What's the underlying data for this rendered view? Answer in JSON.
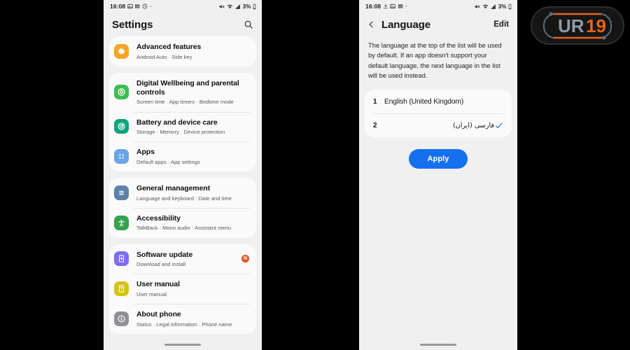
{
  "status_bar": {
    "time": "16:08",
    "battery": "3%",
    "left_icons": [
      "gallery-icon",
      "apps-icon",
      "clock-icon",
      "dot-icon"
    ],
    "right_icons": [
      "mute-icon",
      "wifi-icon",
      "signal-icon"
    ]
  },
  "settings_screen": {
    "title": "Settings",
    "search_icon": "search-icon",
    "groups": [
      {
        "rows": [
          {
            "title": "Advanced features",
            "subtitle": "Android Auto  ·  Side key",
            "icon": "advanced-features-icon",
            "color": "#f5a623",
            "badge": ""
          }
        ]
      },
      {
        "rows": [
          {
            "title": "Digital Wellbeing and parental controls",
            "subtitle": "Screen time  ·  App timers  ·  Bedtime mode",
            "icon": "digital-wellbeing-icon",
            "color": "#3ebd4f",
            "badge": ""
          },
          {
            "title": "Battery and device care",
            "subtitle": "Storage  ·  Memory  ·  Device protection",
            "icon": "battery-device-care-icon",
            "color": "#10a37f",
            "badge": ""
          },
          {
            "title": "Apps",
            "subtitle": "Default apps  ·  App settings",
            "icon": "apps-grid-icon",
            "color": "#6ba4e8",
            "badge": ""
          }
        ]
      },
      {
        "rows": [
          {
            "title": "General management",
            "subtitle": "Language and keyboard  ·  Date and time",
            "icon": "general-management-icon",
            "color": "#5b82ab",
            "badge": ""
          },
          {
            "title": "Accessibility",
            "subtitle": "TalkBack  ·  Mono audio  ·  Assistant menu",
            "icon": "accessibility-icon",
            "color": "#36a34a",
            "badge": ""
          }
        ]
      },
      {
        "rows": [
          {
            "title": "Software update",
            "subtitle": "Download and install",
            "icon": "software-update-icon",
            "color": "#7b6ef0",
            "badge": "N"
          },
          {
            "title": "User manual",
            "subtitle": "User manual",
            "icon": "user-manual-icon",
            "color": "#d4c21a",
            "badge": ""
          },
          {
            "title": "About phone",
            "subtitle": "Status  ·  Legal information  ·  Phone name",
            "icon": "about-phone-icon",
            "color": "#8e8e93",
            "badge": ""
          }
        ]
      }
    ]
  },
  "language_screen": {
    "back_icon": "chevron-left-icon",
    "title": "Language",
    "edit_label": "Edit",
    "description": "The language at the top of the list will be used by default. If an app doesn't support your default language, the next language in the list will be used instead.",
    "languages": [
      {
        "number": "1",
        "name": "English (United Kingdom)",
        "selected": false
      },
      {
        "number": "2",
        "name": "فارسی (ایران)",
        "selected": true
      }
    ],
    "apply_label": "Apply",
    "accent_color": "#1570ef"
  },
  "watermark": {
    "text_primary": "UR",
    "text_secondary": "19",
    "primary_color": "#8d9aa5",
    "secondary_color": "#e8631a"
  }
}
